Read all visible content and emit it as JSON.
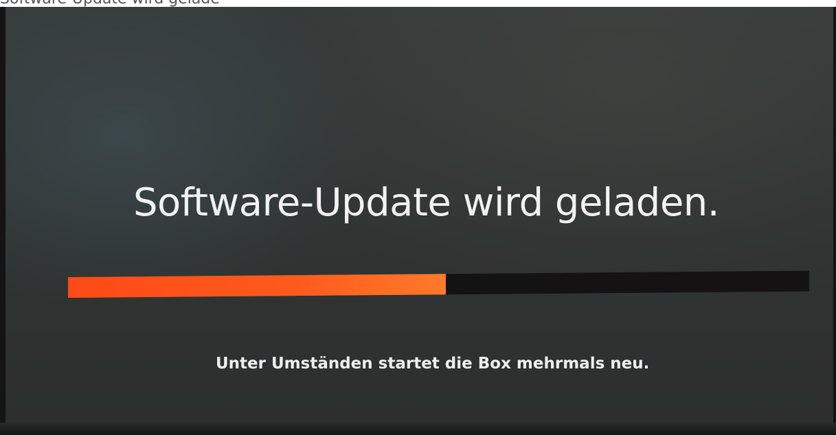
{
  "caption": {
    "text": "Software-Update wird geladen"
  },
  "screen": {
    "headline": "Software-Update wird geladen.",
    "progress": {
      "value": 0.51,
      "fill_color": "#ff4a16",
      "track_color": "#141213"
    },
    "subtitle": "Unter Umständen startet die Box mehrmals neu."
  }
}
